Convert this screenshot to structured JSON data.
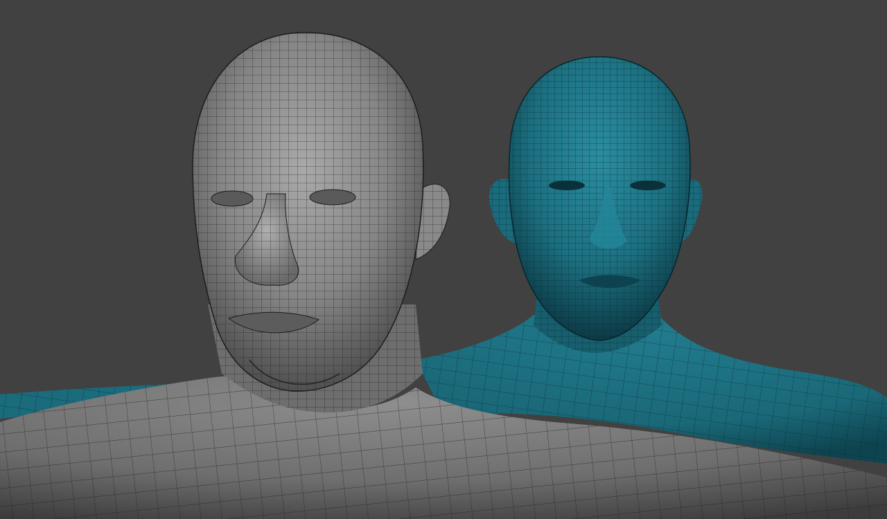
{
  "viewport": {
    "background": "#414141"
  },
  "models": [
    {
      "id": "grey",
      "base_color": "#7b7b7b",
      "light_color": "#a9a9a9",
      "dark_color": "#2f2f2f",
      "wire_color": "#1c1c1c"
    },
    {
      "id": "teal",
      "base_color": "#1a6b7c",
      "light_color": "#2a8ea0",
      "dark_color": "#0c3a45",
      "wire_color": "#06252c"
    }
  ]
}
